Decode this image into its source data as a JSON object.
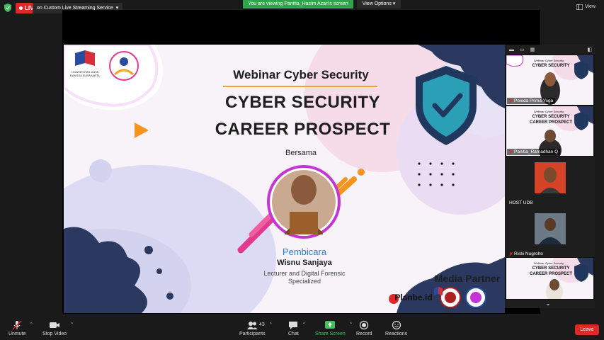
{
  "top_bar": {
    "live_label": "LIVE",
    "live_service": "on Custom Live Streaming Service",
    "viewing_banner": "You are viewing Panitia_Hasim Azari's screen",
    "view_options": "View Options",
    "view_button": "View"
  },
  "slide": {
    "univ_logo_text": "UNIVERSITAS DUTA BANGSA SURAKARTA",
    "heading": "Webinar Cyber Security",
    "title_line1": "CYBER SECURITY",
    "title_line2": "CAREER PROSPECT",
    "bersama": "Bersama",
    "pembicara_label": "Pembicara",
    "speaker_name": "Wisnu Sanjaya",
    "speaker_role": "Lecturer and Digital Forensic Specialized",
    "media_partner": "Media Partner",
    "planbe": "Planbe.id",
    "bem_label": "BEM FICOM"
  },
  "participant_panel": {
    "tiles": [
      {
        "name": "Peleda Prima Yoga",
        "type": "screen"
      },
      {
        "name": "Panitia_Ramadhan Q",
        "type": "screen"
      },
      {
        "name": "HOST UDB",
        "type": "avatar"
      },
      {
        "name": "Riski Nugroho",
        "type": "avatar"
      },
      {
        "name": "",
        "type": "screen"
      }
    ],
    "mini_slide": {
      "title": "Webinar Cyber Security",
      "line1": "CYBER SECURITY",
      "line2": "CAREER PROSPECT"
    }
  },
  "toolbar": {
    "unmute": "Unmute",
    "stop_video": "Stop Video",
    "participants": "Participants",
    "participants_count": "43",
    "chat": "Chat",
    "share_screen": "Share Screen",
    "record": "Record",
    "reactions": "Reactions",
    "leave": "Leave"
  },
  "colors": {
    "live_red": "#e02828",
    "banner_green": "#2da54a",
    "share_green": "#3ec35b",
    "slide_bg": "#f7f3f9",
    "shield_navy": "#1f3a64",
    "accent_orange": "#f7941d"
  }
}
